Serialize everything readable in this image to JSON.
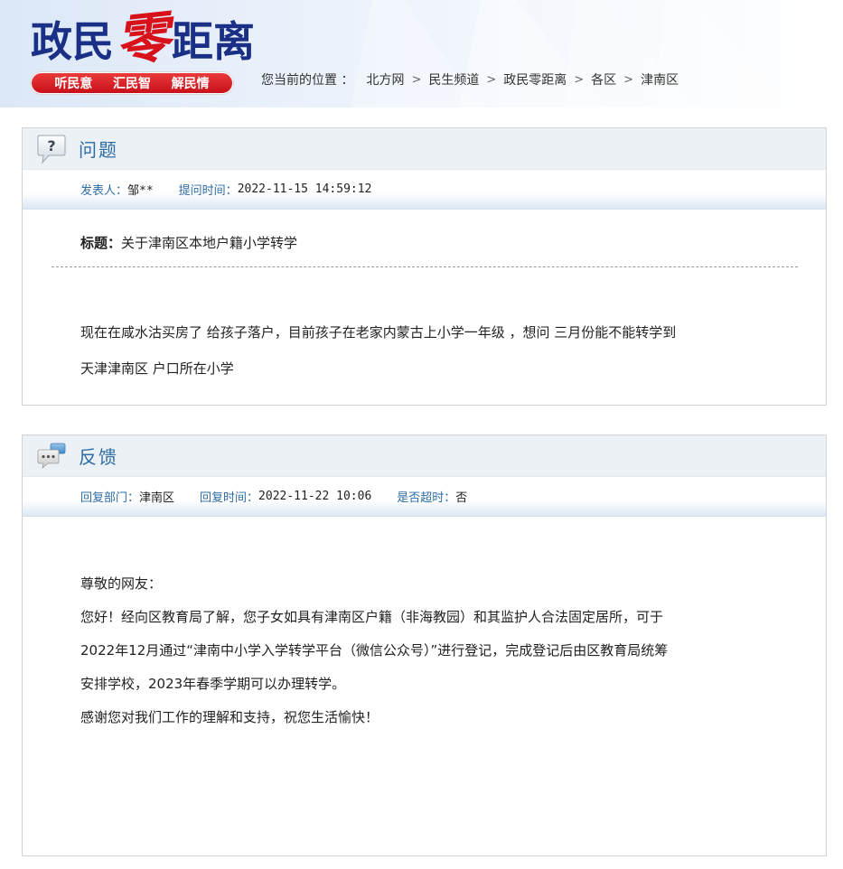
{
  "header": {
    "logo_part1": "政民",
    "logo_accent": "零",
    "logo_part2": "距离",
    "slogans": [
      "听民意",
      "汇民智",
      "解民情"
    ],
    "breadcrumb_label": "您当前的位置 ：",
    "breadcrumb": [
      "北方网",
      "民生频道",
      "政民零距离",
      "各区",
      "津南区"
    ]
  },
  "question": {
    "section_title": "问题",
    "poster_label": "发表人：",
    "poster": "邹**",
    "time_label": "提问时间：",
    "time": "2022-11-15 14:59:12",
    "title_label": "标题：",
    "title": "关于津南区本地户籍小学转学",
    "body_lines": [
      "现在在咸水沽买房了 给孩子落户，目前孩子在老家内蒙古上小学一年级 ，想问 三月份能不能转学到",
      "天津津南区 户口所在小学"
    ]
  },
  "feedback": {
    "section_title": "反馈",
    "dept_label": "回复部门：",
    "dept": "津南区",
    "time_label": "回复时间：",
    "time": "2022-11-22 10:06",
    "overdue_label": "是否超时：",
    "overdue": "否",
    "body_lines": [
      "尊敬的网友：",
      "您好！经向区教育局了解，您子女如具有津南区户籍（非海教园）和其监护人合法固定居所，可于",
      "2022年12月通过“津南中小学入学转学平台（微信公众号）”进行登记，完成登记后由区教育局统筹",
      "安排学校，2023年春季学期可以办理转学。",
      "感谢您对我们工作的理解和支持，祝您生活愉快！"
    ]
  },
  "colors": {
    "logo_blue": "#1a2f86",
    "logo_red": "#d8121a",
    "accent_blue": "#2d6ca4",
    "slogan_red": "#c8101a"
  }
}
